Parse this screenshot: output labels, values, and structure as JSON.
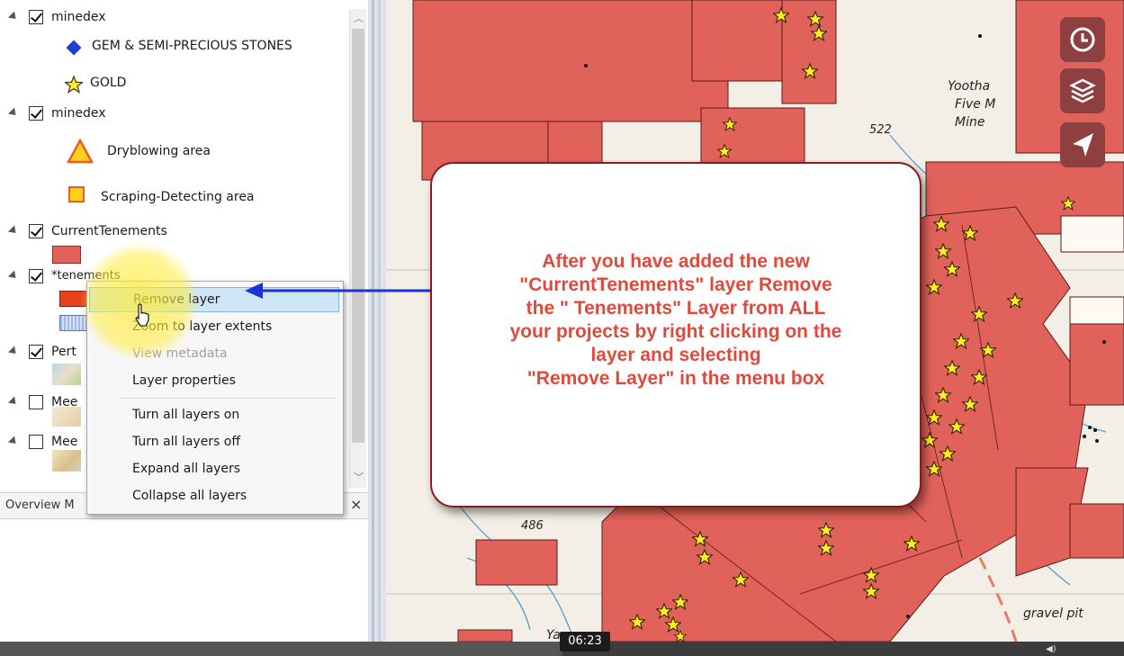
{
  "layers_panel": {
    "rows": [
      {
        "label": "minedex",
        "checked": true
      },
      {
        "label": "minedex",
        "checked": true
      },
      {
        "label": "CurrentTenements",
        "checked": true
      },
      {
        "label": "*tenements",
        "checked": true
      },
      {
        "label": "Pert",
        "checked": true
      },
      {
        "label": "Mee",
        "checked": false
      },
      {
        "label": "Mee",
        "checked": false
      }
    ],
    "legend": {
      "gem": "GEM & SEMI-PRECIOUS STONES",
      "gold": "GOLD",
      "dryblowing": "Dryblowing area",
      "scraping": "Scraping-Detecting area"
    }
  },
  "overview": {
    "title": "Overview M",
    "close": "×"
  },
  "context_menu": {
    "items": [
      "Remove layer",
      "Zoom to layer extents",
      "View metadata",
      "Layer properties",
      "Turn all layers on",
      "Turn all layers off",
      "Expand all layers",
      "Collapse all layers"
    ]
  },
  "callout": {
    "text": "After you have added the new\n\"CurrentTenements\" layer Remove\nthe \" Tenements\" Layer from ALL\nyour projects by right clicking on the\nlayer and selecting\n\"Remove Layer\" in the menu box"
  },
  "map": {
    "labels": [
      "Yootha",
      "Five M",
      "Mine",
      "522",
      "486",
      "gravel pit",
      "Ya"
    ]
  },
  "video": {
    "timestamp": "06:23",
    "progress": 0.5
  },
  "colors": {
    "tenement_fill": "#e0625a",
    "callout_text": "#e04a3c",
    "gold_star": "#ffee22",
    "map_button": "#8e3f3f"
  }
}
